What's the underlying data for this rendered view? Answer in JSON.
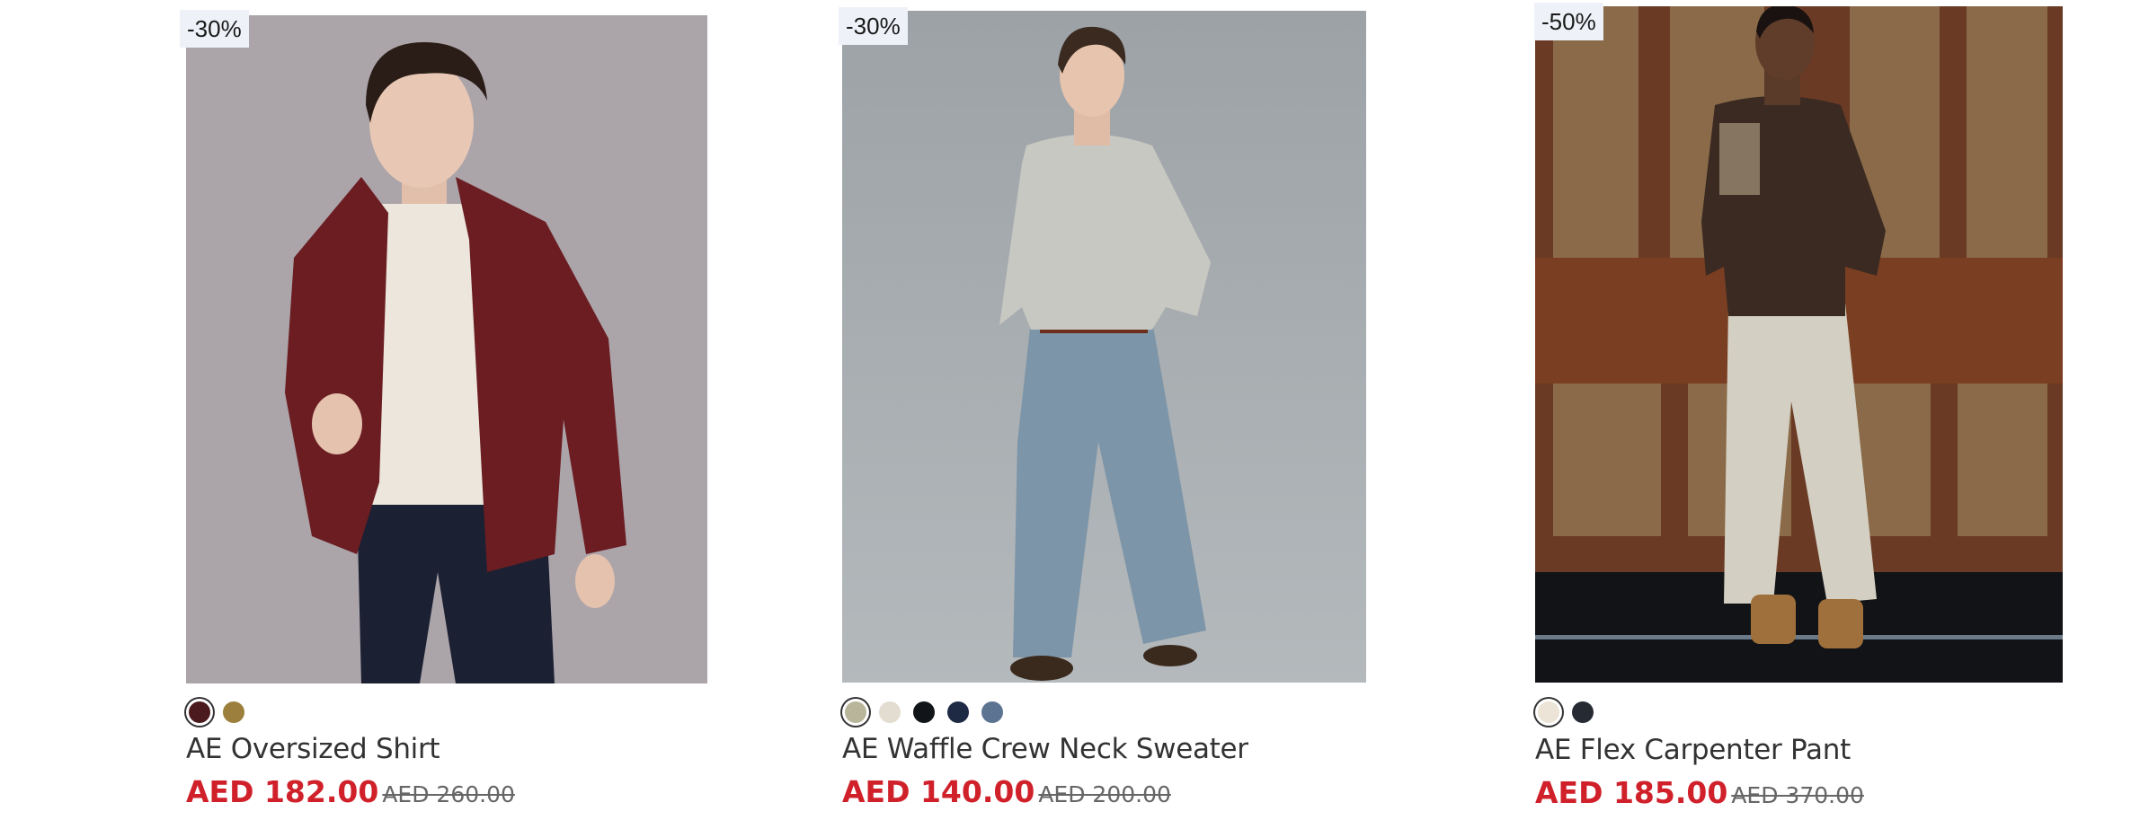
{
  "products": [
    {
      "discount": "-30%",
      "name": "AE Oversized Shirt",
      "sale_price": "AED 182.00",
      "original_price": "AED 260.00",
      "swatches": [
        "#4a1a1f",
        "#9c7f3c"
      ],
      "selected_swatch": 0,
      "accent": "#6b1d22",
      "background": "#aaa3a8"
    },
    {
      "discount": "-30%",
      "name": "AE Waffle Crew Neck Sweater",
      "sale_price": "AED 140.00",
      "original_price": "AED 200.00",
      "swatches": [
        "#b8b59a",
        "#e2ddd0",
        "#111418",
        "#1e2a44",
        "#5c7391"
      ],
      "selected_swatch": 0,
      "accent": "#c9cac4",
      "background": "#9aa0a3"
    },
    {
      "discount": "-50%",
      "name": "AE Flex Carpenter Pant",
      "sale_price": "AED 185.00",
      "original_price": "AED 370.00",
      "swatches": [
        "#ece4d6",
        "#262b33"
      ],
      "selected_swatch": 0,
      "accent": "#d8d4c7",
      "background": "#6a3a24"
    }
  ],
  "colors": {
    "sale_red": "#d0202a",
    "badge_bg": "#eef1f7"
  }
}
